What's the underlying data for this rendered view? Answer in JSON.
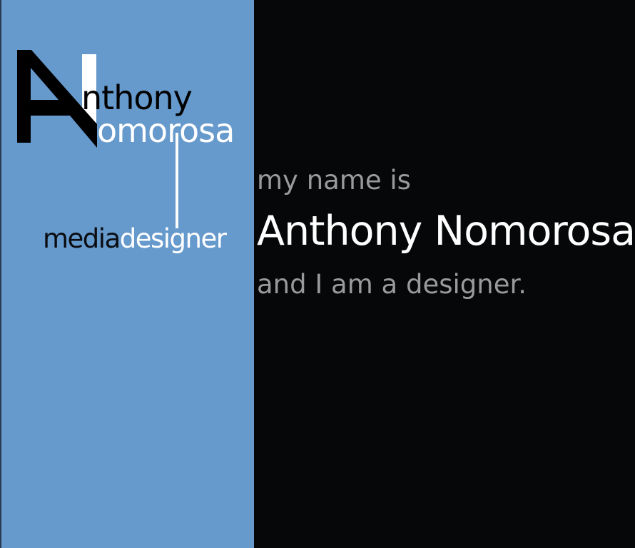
{
  "logo": {
    "letters": [
      "A",
      "N"
    ],
    "first_rest": "nthony",
    "last_rest": "omorosa",
    "tagline_part1": "media",
    "tagline_part2": "designer"
  },
  "intro": {
    "line1": "my name is",
    "name": "Anthony Nomorosa",
    "line3": "and I am a designer."
  },
  "colors": {
    "left_panel": "#6699cc",
    "right_panel": "#050708",
    "muted_text": "#9a9a9a"
  }
}
